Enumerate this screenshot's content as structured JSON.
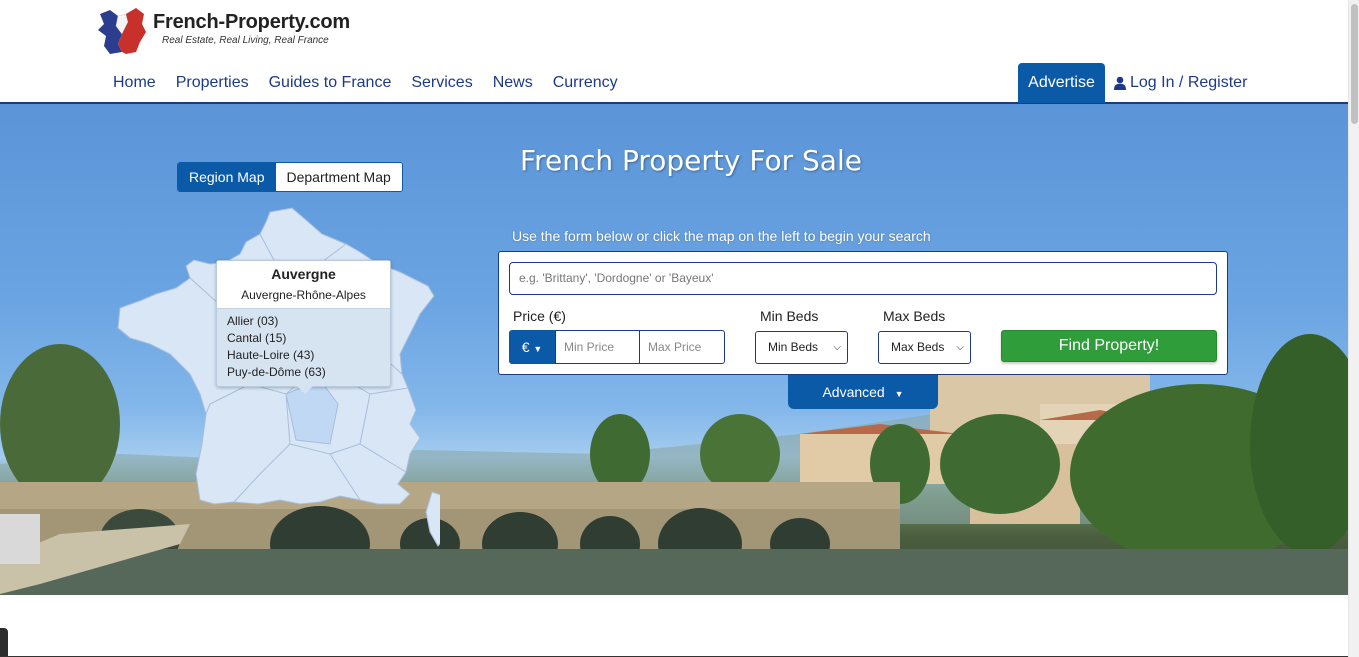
{
  "brand": {
    "name": "French-Property.com",
    "tagline": "Real Estate, Real Living, Real France"
  },
  "nav": {
    "items": [
      "Home",
      "Properties",
      "Guides to France",
      "Services",
      "News",
      "Currency"
    ],
    "advertise": "Advertise",
    "login": "Log In / Register"
  },
  "hero": {
    "title": "French Property For Sale",
    "map_toggle": {
      "region": "Region Map",
      "department": "Department Map"
    },
    "popup": {
      "region": "Auvergne",
      "parent": "Auvergne-Rhône-Alpes",
      "departments": [
        "Allier (03)",
        "Cantal (15)",
        "Haute-Loire (43)",
        "Puy-de-Dôme (63)"
      ]
    },
    "hint": "Use the form below or click the map on the left to begin your search"
  },
  "search": {
    "placeholder": "e.g. 'Brittany', 'Dordogne' or 'Bayeux'",
    "price_label": "Price (€)",
    "currency": "€",
    "min_price_placeholder": "Min Price",
    "max_price_placeholder": "Max Price",
    "min_beds_label": "Min Beds",
    "max_beds_label": "Max Beds",
    "min_beds_value": "Min Beds",
    "max_beds_value": "Max Beds",
    "find_button": "Find Property!",
    "advanced": "Advanced"
  },
  "colors": {
    "accent": "#0b5aa8",
    "nav_text": "#1d3a8a",
    "find_button": "#2f9d3a"
  }
}
